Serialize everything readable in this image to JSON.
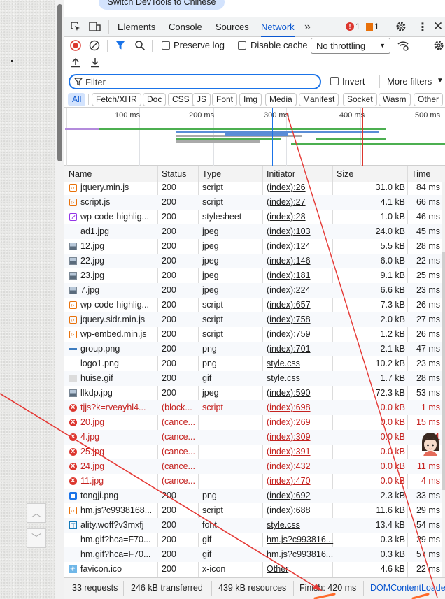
{
  "banner": "Switch DevTools to Chinese",
  "tabs": [
    "Elements",
    "Console",
    "Sources",
    "Network"
  ],
  "badges": {
    "errors": "1",
    "warnings": "1"
  },
  "toolbar": {
    "preserve_log": "Preserve log",
    "disable_cache": "Disable cache",
    "throttling": "No throttling"
  },
  "filter": {
    "placeholder": "Filter",
    "invert": "Invert",
    "more_filters": "More filters"
  },
  "type_filters": [
    "All",
    "Fetch/XHR",
    "Doc",
    "CSS",
    "JS",
    "Font",
    "Img",
    "Media",
    "Manifest",
    "Socket",
    "Wasm",
    "Other"
  ],
  "overview_ticks": [
    "100 ms",
    "200 ms",
    "300 ms",
    "400 ms",
    "500 ms"
  ],
  "columns": [
    "Name",
    "Status",
    "Type",
    "Initiator",
    "Size",
    "Time"
  ],
  "requests": [
    {
      "name": "jquery.min.js",
      "status": "200",
      "type": "script",
      "initiator": "(index):26",
      "size": "31.0 kB",
      "time": "84 ms",
      "icon": "script",
      "error": false
    },
    {
      "name": "script.js",
      "status": "200",
      "type": "script",
      "initiator": "(index):27",
      "size": "4.1 kB",
      "time": "66 ms",
      "icon": "script",
      "error": false
    },
    {
      "name": "wp-code-highlig...",
      "status": "200",
      "type": "stylesheet",
      "initiator": "(index):28",
      "size": "1.0 kB",
      "time": "46 ms",
      "icon": "style",
      "error": false
    },
    {
      "name": "ad1.jpg",
      "status": "200",
      "type": "jpeg",
      "initiator": "(index):103",
      "size": "24.0 kB",
      "time": "45 ms",
      "icon": "imgline",
      "error": false
    },
    {
      "name": "12.jpg",
      "status": "200",
      "type": "jpeg",
      "initiator": "(index):124",
      "size": "5.5 kB",
      "time": "28 ms",
      "icon": "image",
      "error": false
    },
    {
      "name": "22.jpg",
      "status": "200",
      "type": "jpeg",
      "initiator": "(index):146",
      "size": "6.0 kB",
      "time": "22 ms",
      "icon": "image",
      "error": false
    },
    {
      "name": "23.jpg",
      "status": "200",
      "type": "jpeg",
      "initiator": "(index):181",
      "size": "9.1 kB",
      "time": "25 ms",
      "icon": "image",
      "error": false
    },
    {
      "name": "7.jpg",
      "status": "200",
      "type": "jpeg",
      "initiator": "(index):224",
      "size": "6.6 kB",
      "time": "23 ms",
      "icon": "image",
      "error": false
    },
    {
      "name": "wp-code-highlig...",
      "status": "200",
      "type": "script",
      "initiator": "(index):657",
      "size": "7.3 kB",
      "time": "26 ms",
      "icon": "script",
      "error": false
    },
    {
      "name": "jquery.sidr.min.js",
      "status": "200",
      "type": "script",
      "initiator": "(index):758",
      "size": "2.0 kB",
      "time": "27 ms",
      "icon": "script",
      "error": false
    },
    {
      "name": "wp-embed.min.js",
      "status": "200",
      "type": "script",
      "initiator": "(index):759",
      "size": "1.2 kB",
      "time": "26 ms",
      "icon": "script",
      "error": false
    },
    {
      "name": "group.png",
      "status": "200",
      "type": "png",
      "initiator": "(index):701",
      "size": "2.1 kB",
      "time": "47 ms",
      "icon": "imgflat",
      "error": false
    },
    {
      "name": "logo1.png",
      "status": "200",
      "type": "png",
      "initiator": "style.css",
      "size": "10.2 kB",
      "time": "23 ms",
      "icon": "imgline",
      "error": false
    },
    {
      "name": "huise.gif",
      "status": "200",
      "type": "gif",
      "initiator": "style.css",
      "size": "1.7 kB",
      "time": "28 ms",
      "icon": "gif",
      "error": false
    },
    {
      "name": "llkdp.jpg",
      "status": "200",
      "type": "jpeg",
      "initiator": "(index):590",
      "size": "72.3 kB",
      "time": "53 ms",
      "icon": "image",
      "error": false
    },
    {
      "name": "tjjs?k=rveayhl4...",
      "status": "(block...",
      "type": "script",
      "initiator": "(index):698",
      "size": "0.0 kB",
      "time": "1 ms",
      "icon": "error",
      "error": true
    },
    {
      "name": "20.jpg",
      "status": "(cance...",
      "type": "",
      "initiator": "(index):269",
      "size": "0.0 kB",
      "time": "15 ms",
      "icon": "error",
      "error": true
    },
    {
      "name": "4.jpg",
      "status": "(cance...",
      "type": "",
      "initiator": "(index):309",
      "size": "0.0 kB",
      "time": "1",
      "icon": "error",
      "error": true
    },
    {
      "name": "25.jpg",
      "status": "(cance...",
      "type": "",
      "initiator": "(index):391",
      "size": "0.0 kB",
      "time": "",
      "icon": "error",
      "error": true
    },
    {
      "name": "24.jpg",
      "status": "(cance...",
      "type": "",
      "initiator": "(index):432",
      "size": "0.0 kB",
      "time": "11 ms",
      "icon": "error",
      "error": true
    },
    {
      "name": "11.jpg",
      "status": "(cance...",
      "type": "",
      "initiator": "(index):470",
      "size": "0.0 kB",
      "time": "4 ms",
      "icon": "error",
      "error": true
    },
    {
      "name": "tongji.png",
      "status": "200",
      "type": "png",
      "initiator": "(index):692",
      "size": "2.3 kB",
      "time": "33 ms",
      "icon": "blue",
      "error": false
    },
    {
      "name": "hm.js?c9938168...",
      "status": "200",
      "type": "script",
      "initiator": "(index):688",
      "size": "11.6 kB",
      "time": "29 ms",
      "icon": "script",
      "error": false
    },
    {
      "name": "ality.woff?v3mxfj",
      "status": "200",
      "type": "font",
      "initiator": "style.css",
      "size": "13.4 kB",
      "time": "54 ms",
      "icon": "font",
      "error": false
    },
    {
      "name": "hm.gif?hca=F70...",
      "status": "200",
      "type": "gif",
      "initiator": "hm.js?c993816...",
      "size": "0.3 kB",
      "time": "29 ms",
      "icon": "none",
      "error": false
    },
    {
      "name": "hm.gif?hca=F70...",
      "status": "200",
      "type": "gif",
      "initiator": "hm.js?c993816...",
      "size": "0.3 kB",
      "time": "57 ms",
      "icon": "none",
      "error": false
    },
    {
      "name": "favicon.ico",
      "status": "200",
      "type": "x-icon",
      "initiator": "Other",
      "size": "4.6 kB",
      "time": "22 ms",
      "icon": "xicon",
      "error": false
    }
  ],
  "summary": {
    "requests": "33 requests",
    "transferred": "246 kB transferred",
    "resources": "439 kB resources",
    "finish": "Finish: 420 ms",
    "dcl": "DOMContentLoade"
  },
  "colors": {
    "accent": "#0b57d0",
    "error": "#c5221f",
    "annotation_arrow": "#e53935"
  },
  "icons": [
    "element-picker-icon",
    "device-toggle-icon",
    "more-tabs-icon",
    "settings-gear-icon",
    "kebab-menu-icon",
    "close-icon",
    "record-stop-icon",
    "clear-icon",
    "filter-funnel-icon",
    "search-icon",
    "network-conditions-icon",
    "import-har-icon",
    "export-har-icon",
    "chevron-up-icon",
    "chevron-down-icon"
  ]
}
